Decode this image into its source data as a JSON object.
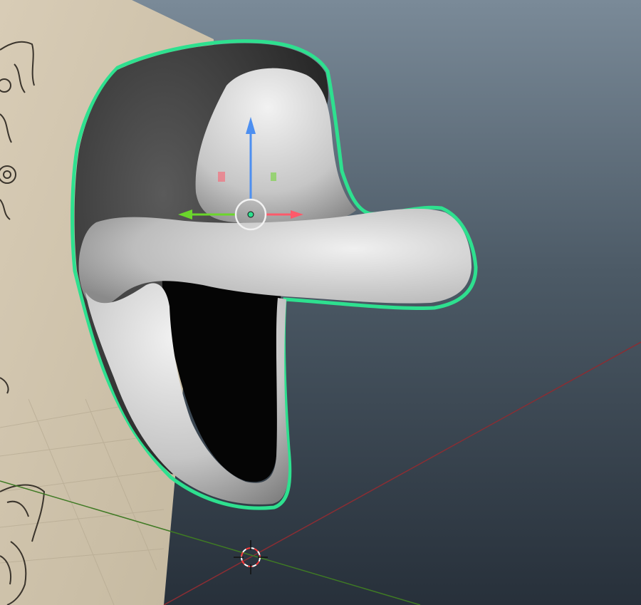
{
  "viewport": {
    "kind": "3d-viewport",
    "background_top": "#7a8a98",
    "background_bottom": "#28313a"
  },
  "reference_image": {
    "paper_color": "#cfc3ae",
    "sketch_color": "#3a342c"
  },
  "mesh": {
    "outline_color": "#2ee08f",
    "selected": true,
    "interior_color": "#050505",
    "outer_shell_color": "#3a3a3a",
    "inner_surface_color": "#c9c9c9"
  },
  "transform_gizmo": {
    "x_axis_color": "#ff5a6a",
    "y_axis_color": "#6bd62b",
    "z_axis_color": "#4d8ff0",
    "pivot_color": "#2ee08f"
  },
  "grid_axes": {
    "x_axis_color": "#8a2d33",
    "y_axis_color": "#3f7a24"
  },
  "cursor_3d": {
    "ring_color_a": "#ff3d3d",
    "ring_color_b": "#ffffff"
  }
}
